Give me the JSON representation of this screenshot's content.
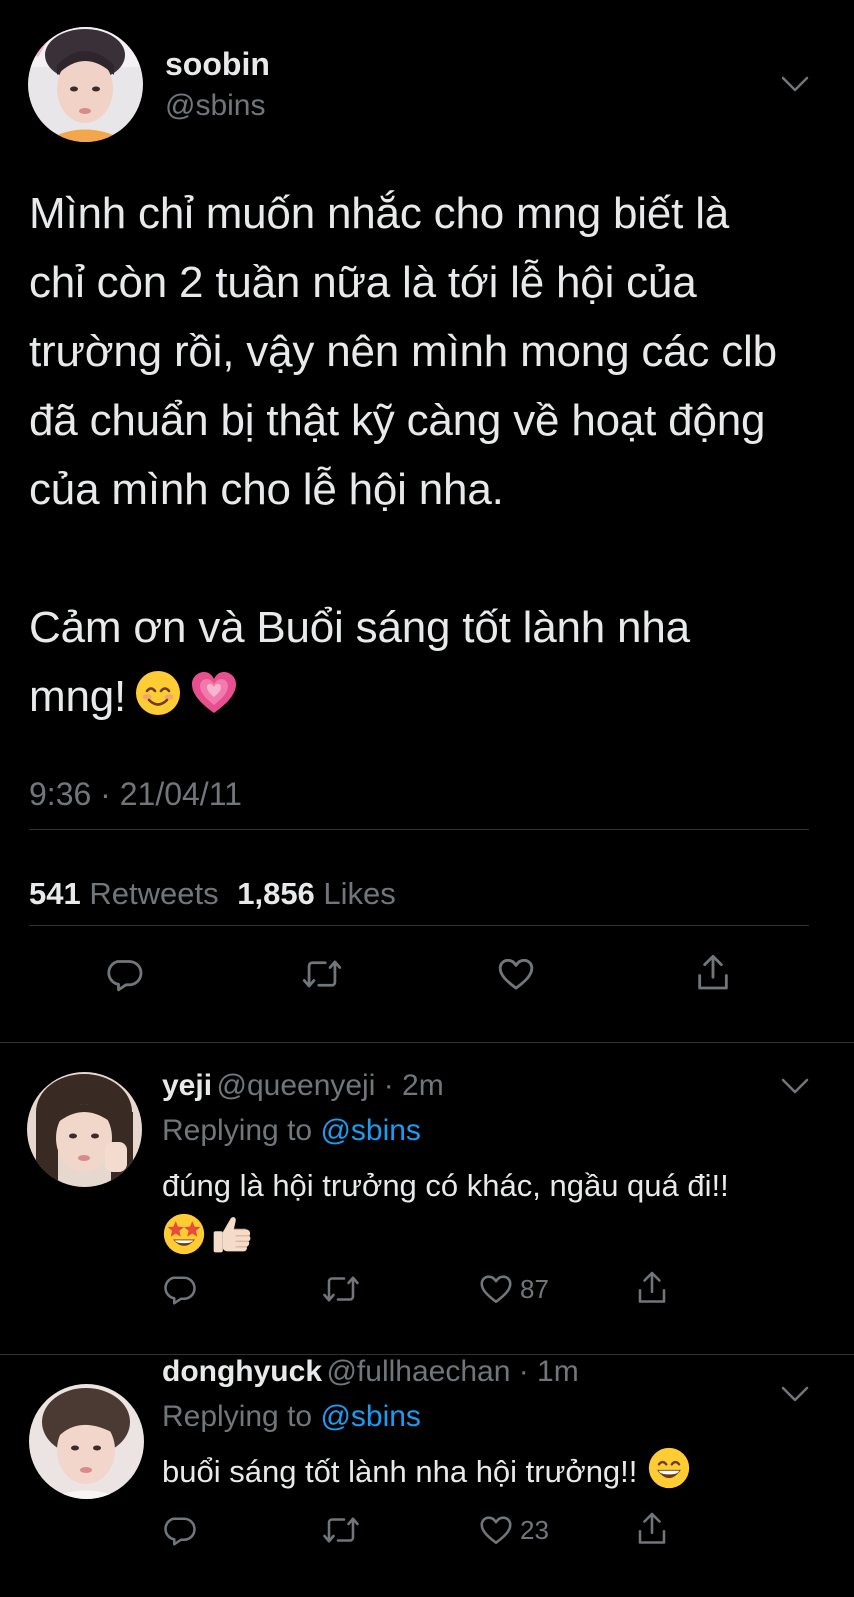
{
  "tweet": {
    "author_name": "soobin",
    "author_handle": "@sbins",
    "text_lines": [
      "Mình chỉ muốn nhắc cho mng biết là",
      "chỉ còn 2 tuần nữa là tới lễ hội của",
      "trường rồi, vậy nên mình mong các clb",
      "đã chuẩn bị thật kỹ càng về hoạt động",
      "của mình cho lễ hội nha."
    ],
    "text_line2_a": "Cảm ơn và Buổi sáng tốt lành nha",
    "text_line2_b": "mng!",
    "emojis": [
      "smiling-face-emoji",
      "growing-heart-emoji"
    ],
    "timestamp": "9:36 · 21/04/11",
    "retweets_count": "541",
    "retweets_label": "Retweets",
    "likes_count": "1,856",
    "likes_label": "Likes",
    "actions": [
      "reply-icon",
      "retweet-icon",
      "like-icon",
      "share-icon"
    ]
  },
  "replies": [
    {
      "name": "yeji",
      "handle": "@queenyeji · 2m",
      "replying_prefix": "Replying to",
      "replying_mention": "@sbins",
      "text_lines": [
        "đúng là hội trưởng có khác, ngầu quá đi!!"
      ],
      "emojis": [
        "star-struck-emoji",
        "thumbs-up-emoji"
      ],
      "like_count": "87"
    },
    {
      "name": "donghyuck",
      "handle": "@fullhaechan · 1m",
      "replying_prefix": "Replying to",
      "replying_mention": "@sbins",
      "text_lines": [
        "buổi sáng tốt lành nha hội trưởng!!"
      ],
      "emojis": [
        "grinning-face-emoji"
      ],
      "like_count": "23"
    }
  ],
  "colors": {
    "background": "#000000",
    "text": "#e7e9ea",
    "secondary": "#71767b",
    "divider": "#2f3336",
    "accent": "#1d9bf0"
  }
}
